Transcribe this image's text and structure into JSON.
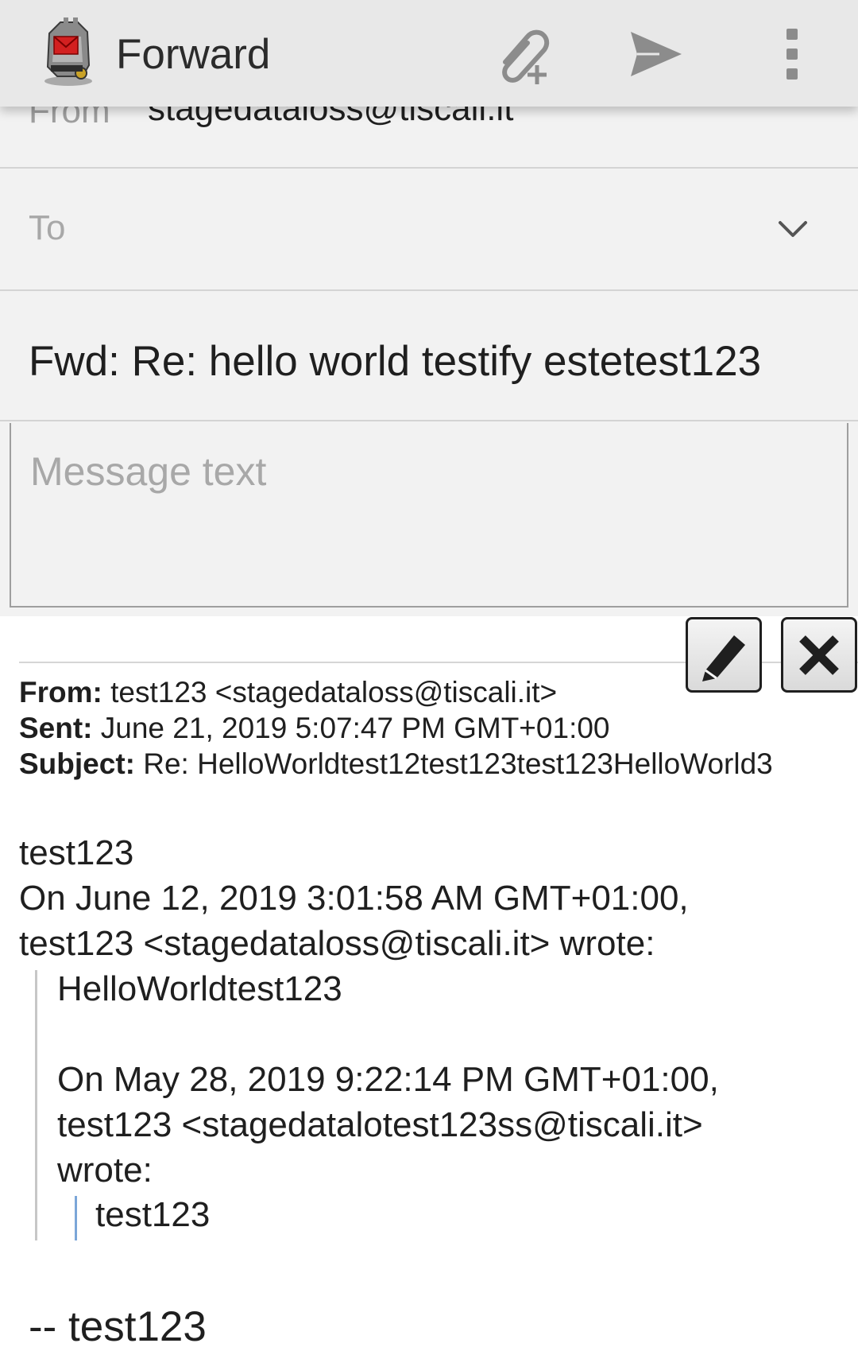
{
  "appbar": {
    "title": "Forward",
    "icons": {
      "logo": "k9-mail-logo",
      "attach": "attach-plus-icon",
      "send": "send-icon",
      "overflow": "more-vert-icon"
    }
  },
  "form": {
    "from_label": "From",
    "from_value": "stagedataloss@tiscali.it",
    "to_label": "To",
    "subject": "Fwd: Re: hello world testify estetest123",
    "message_placeholder": "Message text"
  },
  "quoted": {
    "header": {
      "from_label": "From:",
      "from_value": "test123 <stagedataloss@tiscali.it>",
      "sent_label": "Sent:",
      "sent_value": "June 21, 2019 5:07:47 PM GMT+01:00",
      "subject_label": "Subject:",
      "subject_value": "Re: HelloWorldtest12test123test123HelloWorld3"
    },
    "body_lines": [
      "test123",
      "On June 12, 2019 3:01:58 AM GMT+01:00,",
      "test123 <stagedataloss@tiscali.it> wrote:"
    ],
    "quote_level1": [
      "HelloWorldtest123",
      "On May 28, 2019 9:22:14 PM GMT+01:00,",
      "test123 <stagedatalotest123ss@tiscali.it>",
      "wrote:"
    ],
    "quote_level2": [
      "test123"
    ],
    "signature": "-- test123"
  },
  "colors": {
    "appbar_bg": "#e8e8e8",
    "form_bg": "#f2f2f2",
    "hint_text": "#a8a8a8",
    "quote_bar": "#c7c7c7",
    "nested_quote_bar": "#7ba6d8"
  }
}
